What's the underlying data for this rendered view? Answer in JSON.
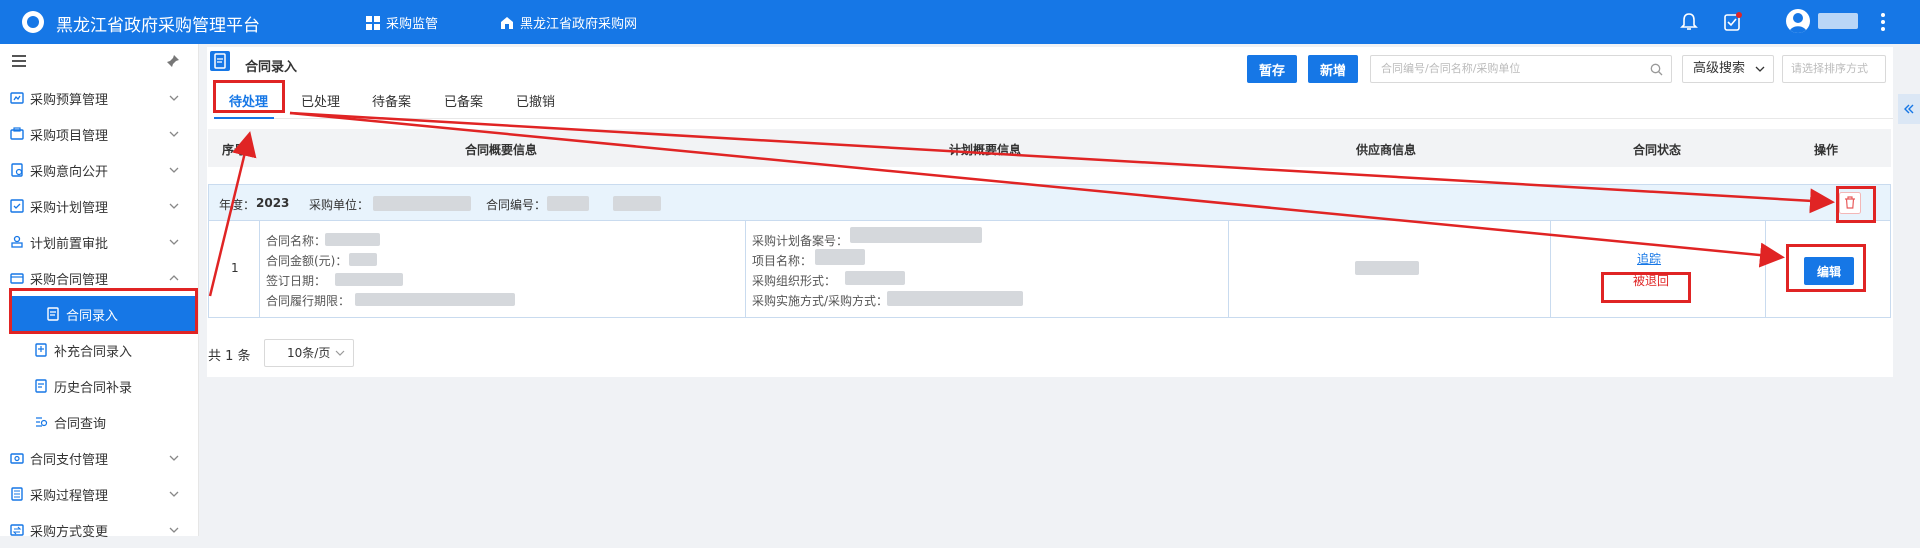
{
  "app": {
    "title": "黑龙江省政府采购管理平台",
    "nav": [
      "采购监管",
      "黑龙江省政府采购网"
    ]
  },
  "sidebar": {
    "items": [
      {
        "label": "采购预算管理",
        "icon": "budget-icon"
      },
      {
        "label": "采购项目管理",
        "icon": "project-icon"
      },
      {
        "label": "采购意向公开",
        "icon": "intention-icon"
      },
      {
        "label": "采购计划管理",
        "icon": "plan-icon"
      },
      {
        "label": "计划前置审批",
        "icon": "approval-icon"
      },
      {
        "label": "采购合同管理",
        "icon": "contract-icon",
        "expanded": true
      },
      {
        "label": "合同录入",
        "icon": "contract-entry-icon",
        "sub": true,
        "active": true
      },
      {
        "label": "补充合同录入",
        "icon": "supplement-icon",
        "sub": true
      },
      {
        "label": "历史合同补录",
        "icon": "history-icon",
        "sub": true
      },
      {
        "label": "合同查询",
        "icon": "query-icon",
        "sub": true
      },
      {
        "label": "合同支付管理",
        "icon": "payment-icon"
      },
      {
        "label": "采购过程管理",
        "icon": "process-icon"
      },
      {
        "label": "采购方式变更",
        "icon": "method-change-icon"
      }
    ]
  },
  "page": {
    "title": "合同录入",
    "buttons": {
      "save": "暂存",
      "add": "新增"
    },
    "search_placeholder": "合同编号/合同名称/采购单位",
    "advanced_search": "高级搜索",
    "sort_placeholder": "请选择排序方式"
  },
  "tabs": [
    "待处理",
    "已处理",
    "待备案",
    "已备案",
    "已撤销"
  ],
  "table": {
    "headers": [
      "序号",
      "合同概要信息",
      "计划概要信息",
      "供应商信息",
      "合同状态",
      "操作"
    ],
    "group": {
      "year_label": "年度：",
      "year": "2023",
      "unit_label": "采购单位：",
      "code_label": "合同编号："
    },
    "row": {
      "index": "1",
      "contract_fields": [
        "合同名称：",
        "合同金额(元)：",
        "签订日期：",
        "合同履行期限："
      ],
      "plan_fields": [
        "采购计划备案号：",
        "项目名称：",
        "采购组织形式：",
        "采购实施方式/采购方式："
      ],
      "status_link": "追踪",
      "status": "被退回",
      "action": "编辑"
    }
  },
  "pagination": {
    "total": "共 1 条",
    "page_size": "10条/页"
  },
  "colors": {
    "primary": "#1677e6",
    "annotation": "#e02424"
  }
}
